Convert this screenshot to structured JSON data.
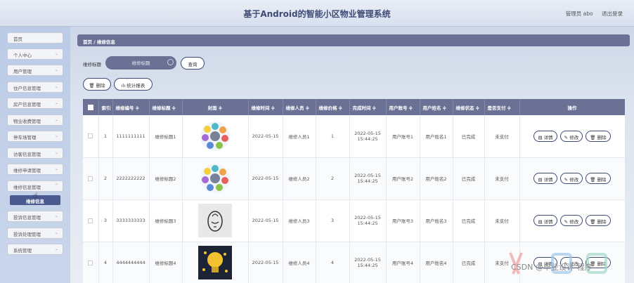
{
  "header": {
    "title": "基于Android的智能小区物业管理系统",
    "admin": "管理员 abo",
    "logout": "退出登录"
  },
  "sidebar": {
    "items": [
      {
        "label": "首页"
      },
      {
        "label": "个人中心"
      },
      {
        "label": "用户管理"
      },
      {
        "label": "住户信息管理"
      },
      {
        "label": "房产信息管理"
      },
      {
        "label": "物业收费管理"
      },
      {
        "label": "停车场管理"
      },
      {
        "label": "访客信息管理"
      },
      {
        "label": "维修申请管理"
      },
      {
        "label": "维修信息管理"
      },
      {
        "label": "投诉信息管理"
      },
      {
        "label": "投诉处理管理"
      },
      {
        "label": "系统管理"
      }
    ],
    "active_sub": "维修信息"
  },
  "breadcrumb": "首页 / 维修信息",
  "search": {
    "label": "维修标题",
    "placeholder": "维修标题",
    "button": "查询"
  },
  "toolbar": {
    "delete": "删除",
    "stats": "统计报表"
  },
  "table": {
    "headers": [
      "索引",
      "维修编号 ≑",
      "维修标题 ≑",
      "封面 ≑",
      "维修时间 ≑",
      "维修人员 ≑",
      "维修价格 ≑",
      "完成时间 ≑",
      "用户账号 ≑",
      "用户姓名 ≑",
      "维修状态 ≑",
      "是否支付 ≑",
      "操作"
    ],
    "rows": [
      {
        "index": "1",
        "code": "1111111111",
        "title": "维修标题1",
        "time": "2022-05-15",
        "worker": "维修人员1",
        "price": "1",
        "done_date": "2022-05-15",
        "done_time": "15:44:25",
        "account": "用户账号1",
        "name": "用户姓名1",
        "status": "已完成",
        "paid": "未支付",
        "cover": "circle-diagram"
      },
      {
        "index": "2",
        "code": "2222222222",
        "title": "维修标题2",
        "time": "2022-05-15",
        "worker": "维修人员2",
        "price": "2",
        "done_date": "2022-05-15",
        "done_time": "15:44:25",
        "account": "用户账号2",
        "name": "用户姓名2",
        "status": "已完成",
        "paid": "未支付",
        "cover": "circle-diagram"
      },
      {
        "index": "3",
        "code": "3333333333",
        "title": "维修标题3",
        "time": "2022-05-15",
        "worker": "维修人员3",
        "price": "3",
        "done_date": "2022-05-15",
        "done_time": "15:44:25",
        "account": "用户账号3",
        "name": "用户姓名3",
        "status": "已完成",
        "paid": "未支付",
        "cover": "sketch-logo"
      },
      {
        "index": "4",
        "code": "4444444444",
        "title": "维修标题4",
        "time": "2022-05-15",
        "worker": "维修人员4",
        "price": "4",
        "done_date": "2022-05-15",
        "done_time": "15:44:25",
        "account": "用户账号4",
        "name": "用户姓名4",
        "status": "已完成",
        "paid": "未支付",
        "cover": "lightbulb"
      }
    ],
    "actions": {
      "detail": "详情",
      "edit": "修改",
      "delete": "删除"
    }
  },
  "watermark": "CSDN @毕业设计-程序"
}
